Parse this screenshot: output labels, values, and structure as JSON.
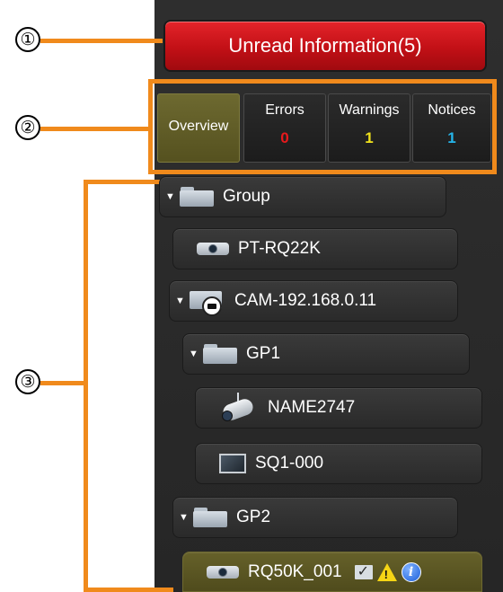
{
  "callouts": [
    "①",
    "②",
    "③"
  ],
  "unread_button": {
    "label": "Unread Information(5)"
  },
  "tabs": [
    {
      "label": "Overview",
      "count": "",
      "active": true
    },
    {
      "label": "Errors",
      "count": "0",
      "count_color": "#e8191c"
    },
    {
      "label": "Warnings",
      "count": "1",
      "count_color": "#f0e21c"
    },
    {
      "label": "Notices",
      "count": "1",
      "count_color": "#25b5ea"
    }
  ],
  "tree": [
    {
      "label": "Group",
      "icon": "folder-icon",
      "expanded": true
    },
    {
      "label": "PT-RQ22K",
      "icon": "projector-icon"
    },
    {
      "label": "CAM-192.168.0.11",
      "icon": "camera-group-icon",
      "expanded": true
    },
    {
      "label": "GP1",
      "icon": "folder-icon",
      "expanded": true
    },
    {
      "label": "NAME2747",
      "icon": "network-camera-icon"
    },
    {
      "label": "SQ1-000",
      "icon": "display-icon"
    },
    {
      "label": "GP2",
      "icon": "folder-icon",
      "expanded": true
    },
    {
      "label": "RQ50K_001",
      "icon": "projector-icon",
      "selected": true,
      "status_icons": [
        "mail-check-icon",
        "warning-icon",
        "info-icon"
      ]
    }
  ],
  "colors": {
    "accent_orange": "#f08a1c",
    "alert_red": "#d0161b",
    "selected_olive": "#5d5925"
  }
}
